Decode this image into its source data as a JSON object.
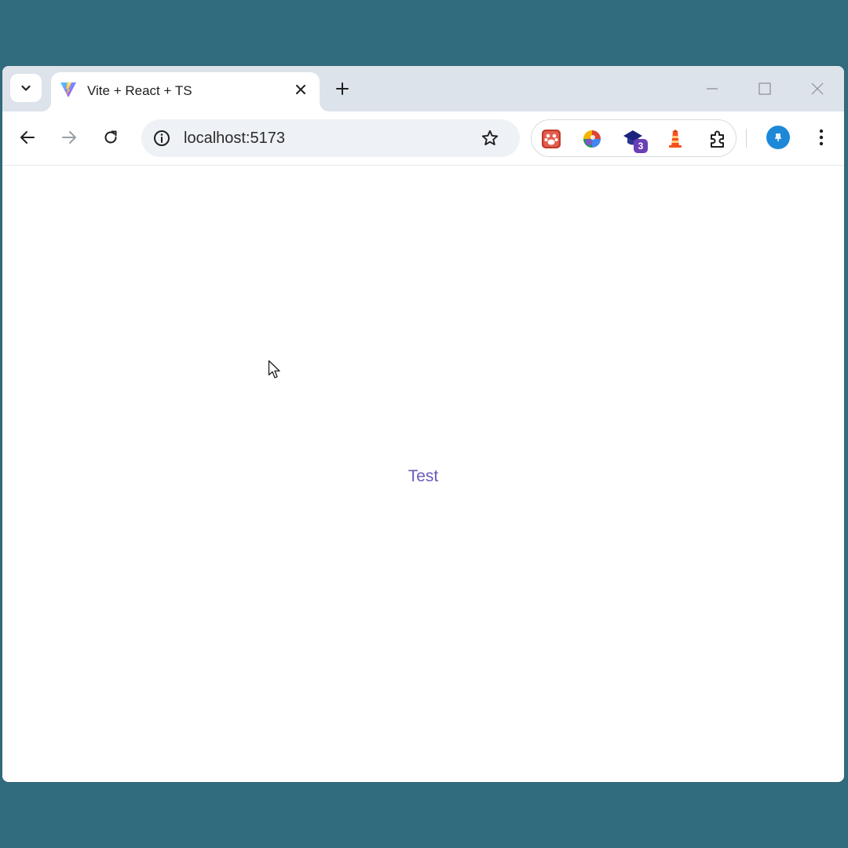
{
  "browser": {
    "tab": {
      "title": "Vite + React + TS",
      "favicon": "vite-logo-icon"
    },
    "tab_search_icon": "chevron-down-icon",
    "new_tab_icon": "plus-icon",
    "window_controls": [
      "minimize-icon",
      "maximize-icon",
      "close-icon"
    ],
    "toolbar": {
      "back_icon": "arrow-left-icon",
      "forward_icon": "arrow-right-icon",
      "reload_icon": "reload-icon",
      "address": "localhost:5173",
      "site_info_icon": "info-icon",
      "bookmark_icon": "star-icon"
    },
    "extensions": {
      "badge_count": "3",
      "items": [
        "paw-extension-icon",
        "colorful-extension-icon",
        "graduation-cap-extension-icon",
        "lighthouse-extension-icon",
        "puzzle-icon"
      ]
    },
    "profile_icon": "profile-avatar",
    "menu_icon": "kebab-menu-icon"
  },
  "page": {
    "text": "Test"
  },
  "colors": {
    "desktop_background": "#316b7e",
    "tab_strip": "#dde3ea",
    "link_text": "#6b5bb8",
    "profile": "#1e88d8"
  }
}
